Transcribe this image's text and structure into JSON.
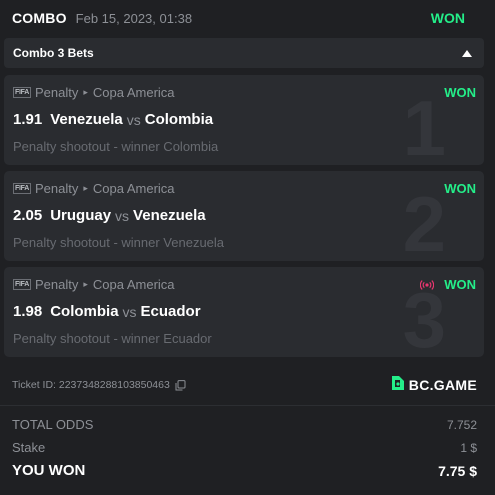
{
  "header": {
    "type": "COMBO",
    "date": "Feb 15, 2023, 01:38",
    "status": "WON"
  },
  "combo": {
    "label": "Combo 3 Bets",
    "toggle_icon": "caret-up-icon"
  },
  "bets": [
    {
      "logo": "FIFA",
      "sport": "Penalty",
      "league": "Copa America",
      "status": "WON",
      "live": false,
      "odds": "1.91",
      "home": "Venezuela",
      "vs": "vs",
      "away": "Colombia",
      "selection": "Penalty shootout - winner Colombia",
      "index": "1"
    },
    {
      "logo": "FIFA",
      "sport": "Penalty",
      "league": "Copa America",
      "status": "WON",
      "live": false,
      "odds": "2.05",
      "home": "Uruguay",
      "vs": "vs",
      "away": "Venezuela",
      "selection": "Penalty shootout - winner Venezuela",
      "index": "2"
    },
    {
      "logo": "FIFA",
      "sport": "Penalty",
      "league": "Copa America",
      "status": "WON",
      "live": true,
      "odds": "1.98",
      "home": "Colombia",
      "vs": "vs",
      "away": "Ecuador",
      "selection": "Penalty shootout - winner Ecuador",
      "index": "3"
    }
  ],
  "ticket": {
    "text": "Ticket ID: 2237348288103850463",
    "copy_icon": "copy-icon"
  },
  "brand": {
    "name": "BC.GAME",
    "logo_icon": "bcgame-logo-icon"
  },
  "totals": {
    "odds_label": "TOTAL ODDS",
    "odds_value": "7.752",
    "stake_label": "Stake",
    "stake_value": "1 $",
    "won_label": "YOU WON",
    "won_value": "7.75 $"
  },
  "colors": {
    "background": "#1f2023",
    "card": "#2a2c30",
    "won_green": "#24ee89",
    "live_pink": "#e8366f",
    "muted": "#8d9096"
  }
}
